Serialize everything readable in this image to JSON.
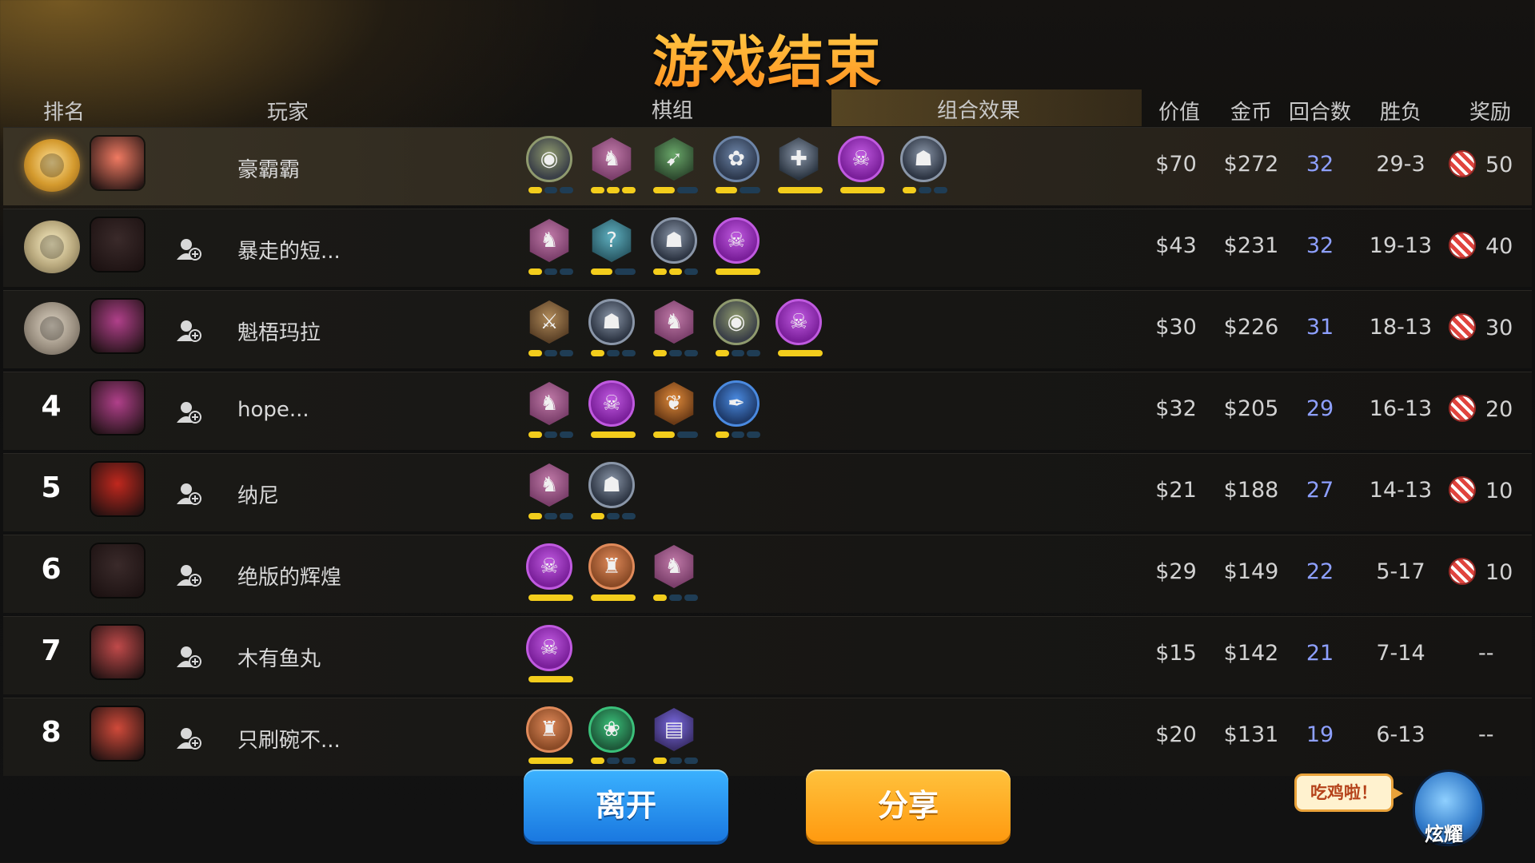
{
  "title": "游戏结束",
  "headers": {
    "rank": "排名",
    "player": "玩家",
    "lineup": "棋组",
    "combo": "组合效果",
    "value": "价值",
    "gold": "金币",
    "rounds": "回合数",
    "record": "胜负",
    "reward": "奖励"
  },
  "rows": [
    {
      "rank": "",
      "medal": "gold",
      "name": "豪霸霸",
      "value": "$70",
      "gold": "$272",
      "rounds": "32",
      "record": "29-3",
      "reward": "50",
      "has_candy": true,
      "units": [
        {
          "shape": "circle",
          "color": "#3a3f47",
          "border": "#8f9a6e",
          "icon": "owl-icon",
          "glyph": "◉",
          "pips": [
            1,
            0,
            0
          ]
        },
        {
          "shape": "hex",
          "color": "#7a3e6a",
          "border": "#c07aa8",
          "icon": "knight-icon",
          "glyph": "♞",
          "pips": [
            1,
            1,
            1
          ]
        },
        {
          "shape": "hex",
          "color": "#2e4a2f",
          "border": "#6aa86a",
          "icon": "bow-icon",
          "glyph": "➹",
          "pips": [
            1,
            0
          ]
        },
        {
          "shape": "circle",
          "color": "#2e3a4f",
          "border": "#6d85a8",
          "icon": "spiral-icon",
          "glyph": "✿",
          "pips": [
            1,
            0
          ]
        },
        {
          "shape": "hex",
          "color": "#2a3440",
          "border": "#8a96a8",
          "icon": "cross-icon",
          "glyph": "✚",
          "pips": [
            1
          ]
        },
        {
          "shape": "circle",
          "color": "#7a1f9a",
          "border": "#c05ae0",
          "icon": "demon-icon",
          "glyph": "☠",
          "pips": [
            1
          ]
        },
        {
          "shape": "circle",
          "color": "#2e3644",
          "border": "#8a96a8",
          "icon": "gauntlet-icon",
          "glyph": "☗",
          "pips": [
            1,
            0,
            0
          ]
        }
      ]
    },
    {
      "rank": "",
      "medal": "silver",
      "name": "暴走的短...",
      "value": "$43",
      "gold": "$231",
      "rounds": "32",
      "record": "19-13",
      "reward": "40",
      "has_candy": true,
      "units": [
        {
          "shape": "hex",
          "color": "#7a3e6a",
          "border": "#c07aa8",
          "icon": "knight-icon",
          "glyph": "♞",
          "pips": [
            1,
            0,
            0
          ]
        },
        {
          "shape": "hex",
          "color": "#2a5a66",
          "border": "#5fb0c0",
          "icon": "rune-icon",
          "glyph": "?",
          "pips": [
            1,
            0
          ]
        },
        {
          "shape": "circle",
          "color": "#2e3644",
          "border": "#8a96a8",
          "icon": "gauntlet-icon",
          "glyph": "☗",
          "pips": [
            1,
            1,
            0
          ]
        },
        {
          "shape": "circle",
          "color": "#7a1f9a",
          "border": "#c05ae0",
          "icon": "demon-icon",
          "glyph": "☠",
          "pips": [
            1
          ]
        }
      ]
    },
    {
      "rank": "",
      "medal": "bronze",
      "name": "魁梧玛拉",
      "value": "$30",
      "gold": "$226",
      "rounds": "31",
      "record": "18-13",
      "reward": "30",
      "has_candy": true,
      "units": [
        {
          "shape": "hex",
          "color": "#5a4026",
          "border": "#b08a5a",
          "icon": "axe-icon",
          "glyph": "⚔",
          "pips": [
            1,
            0,
            0
          ]
        },
        {
          "shape": "circle",
          "color": "#2e3644",
          "border": "#8a96a8",
          "icon": "gauntlet-icon",
          "glyph": "☗",
          "pips": [
            1,
            0,
            0
          ]
        },
        {
          "shape": "hex",
          "color": "#7a3e6a",
          "border": "#c07aa8",
          "icon": "knight-icon",
          "glyph": "♞",
          "pips": [
            1,
            0,
            0
          ]
        },
        {
          "shape": "circle",
          "color": "#3a3f47",
          "border": "#8f9a6e",
          "icon": "owl-icon",
          "glyph": "◉",
          "pips": [
            1,
            0,
            0
          ]
        },
        {
          "shape": "circle",
          "color": "#7a1f9a",
          "border": "#c05ae0",
          "icon": "demon-icon",
          "glyph": "☠",
          "pips": [
            1
          ]
        }
      ]
    },
    {
      "rank": "4",
      "medal": "",
      "name": "hope...",
      "value": "$32",
      "gold": "$205",
      "rounds": "29",
      "record": "16-13",
      "reward": "20",
      "has_candy": true,
      "units": [
        {
          "shape": "hex",
          "color": "#7a3e6a",
          "border": "#c07aa8",
          "icon": "knight-icon",
          "glyph": "♞",
          "pips": [
            1,
            0,
            0
          ]
        },
        {
          "shape": "circle",
          "color": "#7a1f9a",
          "border": "#c05ae0",
          "icon": "demon-icon",
          "glyph": "☠",
          "pips": [
            1
          ]
        },
        {
          "shape": "hex",
          "color": "#6a3a16",
          "border": "#e08a3a",
          "icon": "leaf-icon",
          "glyph": "❦",
          "pips": [
            1,
            0
          ]
        },
        {
          "shape": "circle",
          "color": "#1e3a6a",
          "border": "#4a8ae0",
          "icon": "feather-icon",
          "glyph": "✒",
          "pips": [
            1,
            0,
            0
          ]
        }
      ]
    },
    {
      "rank": "5",
      "medal": "",
      "name": "纳尼",
      "value": "$21",
      "gold": "$188",
      "rounds": "27",
      "record": "14-13",
      "reward": "10",
      "has_candy": true,
      "units": [
        {
          "shape": "hex",
          "color": "#7a3e6a",
          "border": "#c07aa8",
          "icon": "knight-icon",
          "glyph": "♞",
          "pips": [
            1,
            0,
            0
          ]
        },
        {
          "shape": "circle",
          "color": "#2e3644",
          "border": "#8a96a8",
          "icon": "gauntlet-icon",
          "glyph": "☗",
          "pips": [
            1,
            0,
            0
          ]
        }
      ]
    },
    {
      "rank": "6",
      "medal": "",
      "name": "绝版的辉煌",
      "value": "$29",
      "gold": "$149",
      "rounds": "22",
      "record": "5-17",
      "reward": "10",
      "has_candy": true,
      "units": [
        {
          "shape": "circle",
          "color": "#7a1f9a",
          "border": "#c05ae0",
          "icon": "demon-icon",
          "glyph": "☠",
          "pips": [
            1
          ]
        },
        {
          "shape": "circle",
          "color": "#8a4a26",
          "border": "#e08a5a",
          "icon": "viking-icon",
          "glyph": "♜",
          "pips": [
            1
          ]
        },
        {
          "shape": "hex",
          "color": "#7a3e6a",
          "border": "#c07aa8",
          "icon": "knight-icon",
          "glyph": "♞",
          "pips": [
            1,
            0,
            0
          ]
        }
      ]
    },
    {
      "rank": "7",
      "medal": "",
      "name": "木有鱼丸",
      "value": "$15",
      "gold": "$142",
      "rounds": "21",
      "record": "7-14",
      "reward": "--",
      "has_candy": false,
      "units": [
        {
          "shape": "circle",
          "color": "#7a1f9a",
          "border": "#c05ae0",
          "icon": "demon-icon",
          "glyph": "☠",
          "pips": [
            1
          ]
        }
      ]
    },
    {
      "rank": "8",
      "medal": "",
      "name": "只刷碗不...",
      "value": "$20",
      "gold": "$131",
      "rounds": "19",
      "record": "6-13",
      "reward": "--",
      "has_candy": false,
      "units": [
        {
          "shape": "circle",
          "color": "#8a4a26",
          "border": "#e08a5a",
          "icon": "viking-icon",
          "glyph": "♜",
          "pips": [
            1
          ]
        },
        {
          "shape": "circle",
          "color": "#1e5a3a",
          "border": "#3ac07a",
          "icon": "paw-icon",
          "glyph": "❀",
          "pips": [
            1,
            0,
            0
          ]
        },
        {
          "shape": "hex",
          "color": "#3a2e6a",
          "border": "#7a6ae0",
          "icon": "tome-icon",
          "glyph": "▤",
          "pips": [
            1,
            0,
            0
          ]
        }
      ]
    }
  ],
  "avatars": [
    "#f07a62",
    "#3a2a2a",
    "#b0408a",
    "#b0408a",
    "#c0281e",
    "#3a2a2a",
    "#c04a4a",
    "#d04a3a"
  ],
  "buttons": {
    "leave": "离开",
    "share": "分享"
  },
  "bubble": "吃鸡啦！",
  "mascot_label": "炫耀"
}
